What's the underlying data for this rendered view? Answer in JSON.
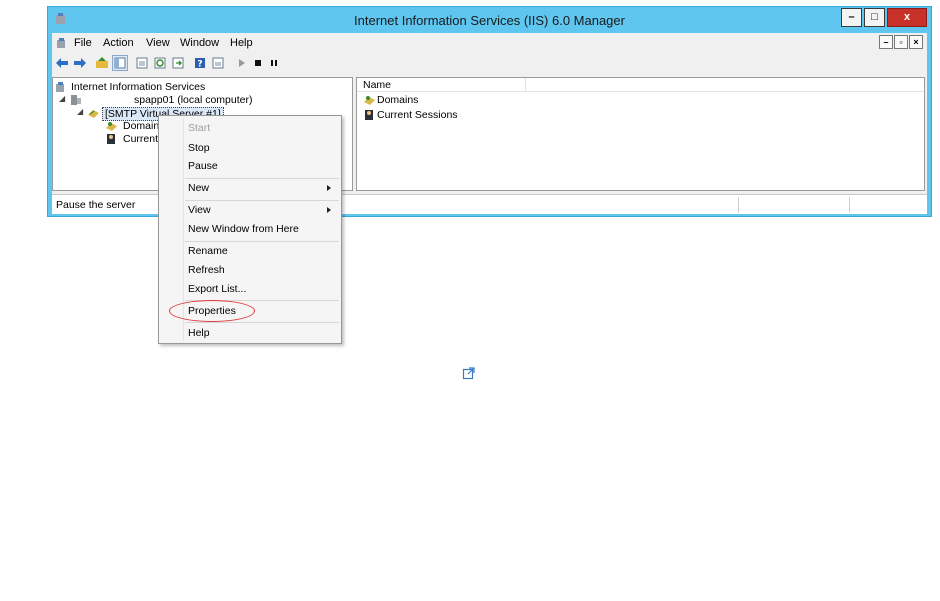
{
  "window": {
    "title": "Internet Information Services (IIS) 6.0 Manager",
    "controls": {
      "minimize": "–",
      "maximize": "□",
      "close": "x"
    }
  },
  "menubar": {
    "items": [
      "File",
      "Action",
      "View",
      "Window",
      "Help"
    ],
    "mdi": {
      "minimize": "–",
      "restore": "▫",
      "close": "×"
    }
  },
  "toolbar": {
    "icons": [
      "back-arrow-icon",
      "forward-arrow-icon",
      "up-folder-icon",
      "show-hide-tree-icon",
      "console-view-icon",
      "refresh-icon",
      "export-list-icon",
      "help-icon",
      "details-view-icon",
      "play-icon",
      "stop-icon",
      "pause-icon"
    ]
  },
  "tree": {
    "root": "Internet Information Services",
    "computer": "spapp01 (local computer)",
    "server": "[SMTP Virtual Server #1]",
    "children": [
      "Domain",
      "Current"
    ]
  },
  "list": {
    "header": "Name",
    "items": [
      "Domains",
      "Current Sessions"
    ]
  },
  "status": {
    "text": "Pause the server"
  },
  "context_menu": {
    "items": [
      {
        "label": "Start",
        "disabled": true
      },
      {
        "label": "Stop"
      },
      {
        "label": "Pause"
      },
      {
        "label": "New",
        "submenu": true
      },
      {
        "label": "View",
        "submenu": true
      },
      {
        "label": "New Window from Here"
      },
      {
        "label": "Rename"
      },
      {
        "label": "Refresh"
      },
      {
        "label": "Export List..."
      },
      {
        "label": "Properties"
      },
      {
        "label": "Help"
      }
    ]
  },
  "colors": {
    "title_bar": "#5ec6ef",
    "close_button": "#c8302a",
    "highlight_ellipse": "#e03a3a"
  }
}
